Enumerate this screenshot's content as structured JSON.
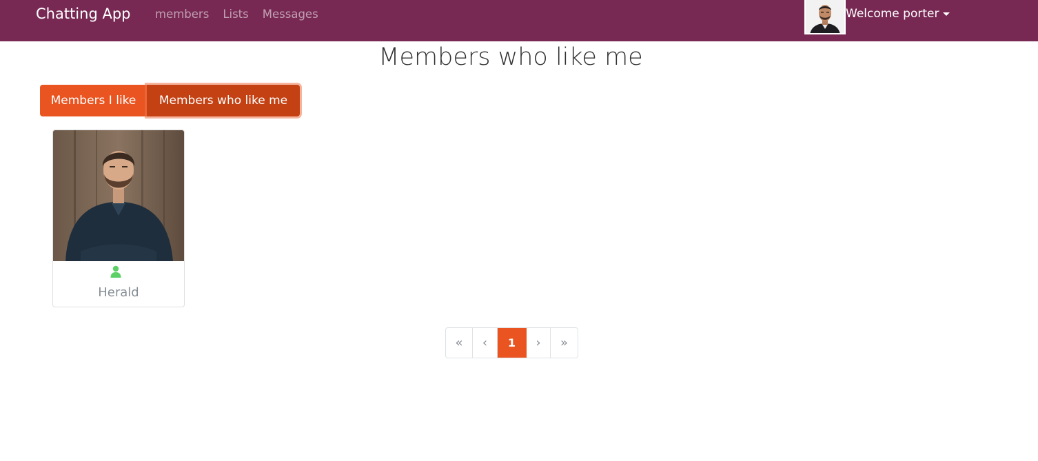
{
  "navbar": {
    "brand": "Chatting App",
    "links": [
      "members",
      "Lists",
      "Messages"
    ],
    "welcome": "Welcome porter"
  },
  "page": {
    "title": "Members who like me"
  },
  "filter_tabs": {
    "members_i_like": "Members I like",
    "members_who_like_me": "Members who like me",
    "active": "members_who_like_me"
  },
  "members": [
    {
      "name": "Herald",
      "online_icon": "user-icon",
      "status_color": "#5cd067"
    }
  ],
  "pagination": {
    "first": "«",
    "prev": "‹",
    "current": "1",
    "next": "›",
    "last": "»"
  },
  "colors": {
    "navbar": "#772953",
    "primary": "#e95420",
    "primary_active": "#c34113"
  }
}
